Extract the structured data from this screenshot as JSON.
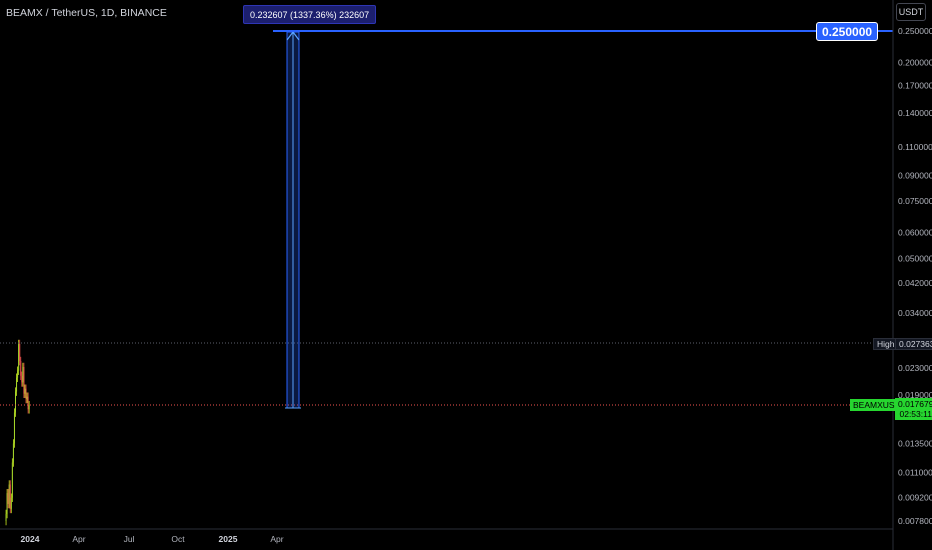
{
  "header": {
    "symbol_title": "BEAMX / TetherUS, 1D, BINANCE",
    "currency_button": "USDT"
  },
  "measure": {
    "label": "0.232607 (1337.36%) 232607",
    "target_label": "0.250000"
  },
  "markers": {
    "high_label": "High",
    "high_value": "0.027363",
    "symbol_tag": "BEAMXUSDT",
    "last_price": "0.017679",
    "countdown": "02:53:11"
  },
  "colors": {
    "background": "#000000",
    "up_candle": "#26a69a",
    "down_candle": "#ef5350",
    "measure_fill": "#2962ff",
    "target_line": "#2962ff",
    "last_price": "#26d62f"
  },
  "chart_data": {
    "type": "line",
    "title": "BEAMX / TetherUS, 1D, BINANCE",
    "y_scale": "log",
    "y_ticks": [
      "0.007800",
      "0.009200",
      "0.011000",
      "0.013500",
      "0.019000",
      "0.023000",
      "0.034000",
      "0.042000",
      "0.050000",
      "0.060000",
      "0.075000",
      "0.090000",
      "0.110000",
      "0.140000",
      "0.170000",
      "0.200000",
      "0.250000"
    ],
    "x_ticks": [
      "2024",
      "Apr",
      "Jul",
      "Oct",
      "2025",
      "Apr"
    ],
    "high": 0.027363,
    "last": 0.017679,
    "target": 0.25,
    "price_path": [
      0.0078,
      0.0082,
      0.0095,
      0.0088,
      0.0101,
      0.0085,
      0.0092,
      0.0118,
      0.0135,
      0.0168,
      0.0195,
      0.0215,
      0.0226,
      0.0273,
      0.0242,
      0.0218,
      0.0208,
      0.0232,
      0.0192,
      0.0199,
      0.0185,
      0.0188,
      0.0172,
      0.0177
    ]
  }
}
